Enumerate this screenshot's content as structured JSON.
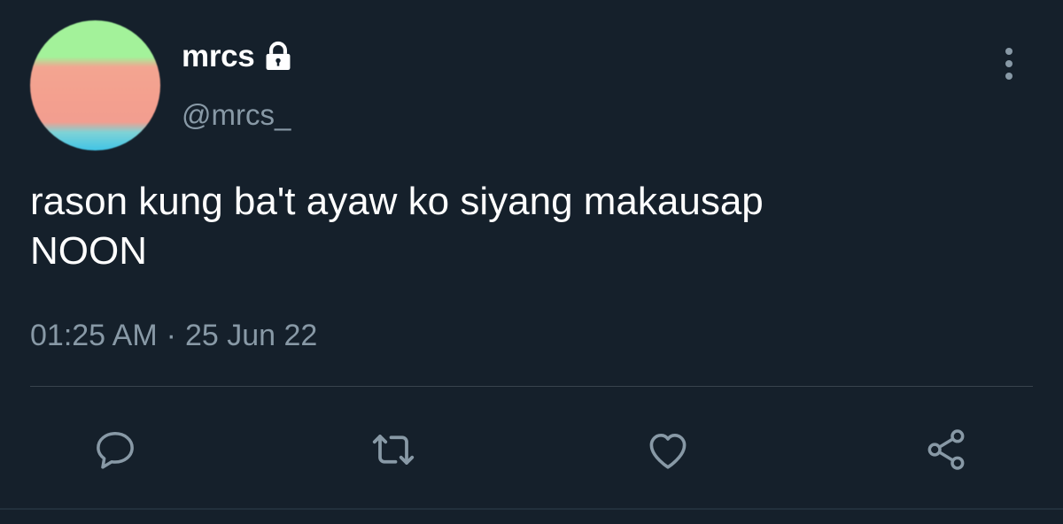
{
  "author": {
    "display_name": "mrcs",
    "handle": "@mrcs_",
    "verified_lock": "lock-icon",
    "avatar_icon": "avatar"
  },
  "tweet": {
    "text_line_1": "rason kung ba't ayaw ko siyang makausap",
    "text_line_2": "NOON",
    "time": "01:25 AM",
    "separator": "·",
    "date": "25 Jun 22"
  },
  "actions": [
    {
      "name": "reply",
      "icon": "reply-icon"
    },
    {
      "name": "retweet",
      "icon": "retweet-icon"
    },
    {
      "name": "like",
      "icon": "heart-icon"
    },
    {
      "name": "share",
      "icon": "share-icon"
    }
  ],
  "colors": {
    "background": "#15202b",
    "text_primary": "#ffffff",
    "text_secondary": "#8899a6",
    "divider": "#38444d"
  }
}
